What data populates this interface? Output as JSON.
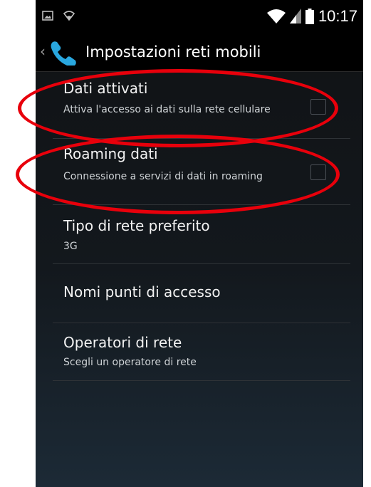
{
  "status_bar": {
    "time": "10:17",
    "icons": [
      "picture-icon",
      "wifi-icon",
      "signal-icon",
      "battery-icon"
    ]
  },
  "action_bar": {
    "back_icon": "chevron-left-icon",
    "app_icon": "phone-icon",
    "title": "Impostazioni reti mobili"
  },
  "preferences": [
    {
      "title": "Dati attivati",
      "summary": "Attiva l'accesso ai dati sulla rete cellulare",
      "checkbox": true,
      "checked": false
    },
    {
      "title": "Roaming dati",
      "summary": "Connessione a servizi di dati in roaming",
      "checkbox": true,
      "checked": false
    },
    {
      "title": "Tipo di rete preferito",
      "summary": "3G",
      "checkbox": false
    },
    {
      "title": "Nomi punti di accesso",
      "summary": "",
      "checkbox": false
    },
    {
      "title": "Operatori di rete",
      "summary": "Scegli un operatore di rete",
      "checkbox": false
    }
  ],
  "colors": {
    "annotation": "#e8000b",
    "background": "#13181d",
    "text": "#f2f2f2"
  }
}
